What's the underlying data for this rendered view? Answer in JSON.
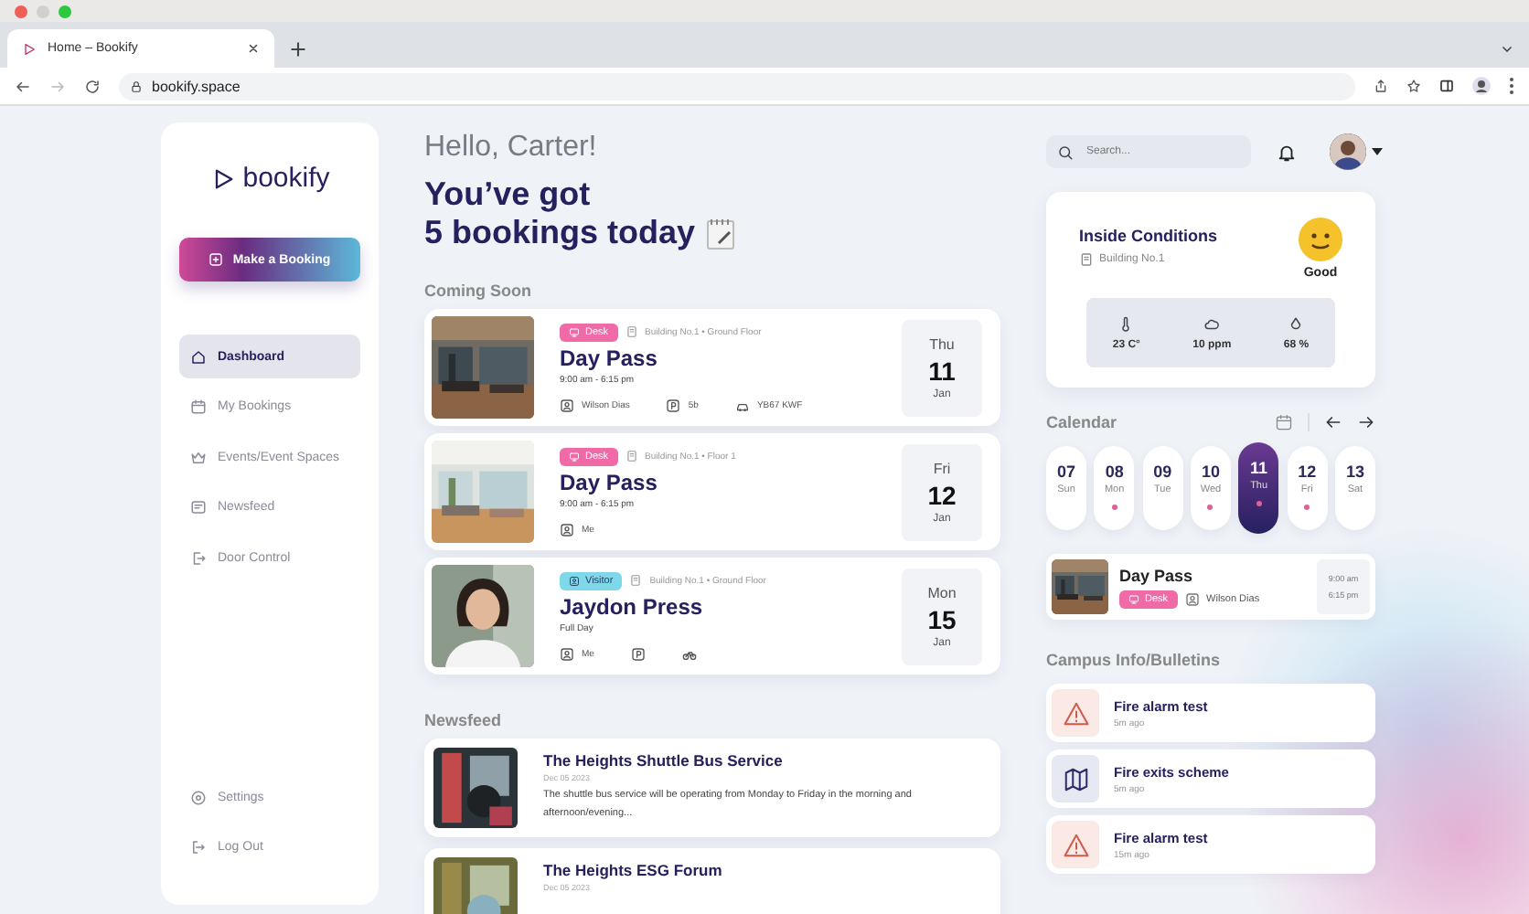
{
  "browser": {
    "tab_title": "Home – Bookify",
    "url": "bookify.space"
  },
  "sidebar": {
    "logo": "bookify",
    "cta": "Make a Booking",
    "nav": [
      {
        "label": "Dashboard",
        "selected": true
      },
      {
        "label": "My Bookings",
        "selected": false
      },
      {
        "label": "Events/Event Spaces",
        "selected": false
      },
      {
        "label": "Newsfeed",
        "selected": false
      },
      {
        "label": "Door Control",
        "selected": false
      }
    ],
    "footer": [
      "Settings",
      "Log Out"
    ]
  },
  "main": {
    "greeting": "Hello, Carter!",
    "headline": [
      "You’ve got",
      "5 bookings today"
    ],
    "coming_soon": {
      "title": "Coming Soon",
      "bookings": [
        {
          "tag": "Desk",
          "kind": "desk",
          "location": "Building No.1 • Ground Floor",
          "title": "Day Pass",
          "time": "9:00 am - 6:15 pm",
          "person": "Wilson Dias",
          "extras": [
            {
              "kind": "parking",
              "text": "5b"
            },
            {
              "kind": "car",
              "text": "YB67 KWF"
            }
          ],
          "day": "Thu",
          "date": "11",
          "month": "Jan"
        },
        {
          "tag": "Desk",
          "kind": "desk",
          "location": "Building No.1 • Floor 1",
          "title": "Day Pass",
          "time": "9:00 am - 6:15 pm",
          "person": "Me",
          "day": "Fri",
          "date": "12",
          "month": "Jan"
        },
        {
          "tag": "Visitor",
          "kind": "visitor",
          "location": "Building No.1 • Ground Floor",
          "title": "Jaydon Press",
          "time": "Full Day",
          "person": "Me",
          "extras": [
            {
              "kind": "parking"
            },
            {
              "kind": "bike"
            }
          ],
          "day": "Mon",
          "date": "15",
          "month": "Jan"
        }
      ]
    },
    "newsfeed": {
      "title": "Newsfeed",
      "items": [
        {
          "title": "The Heights Shuttle Bus Service",
          "date": "Dec 05 2023",
          "body": "The shuttle bus service will be operating from Monday to Friday in the morning and afternoon/evening..."
        },
        {
          "title": "The Heights ESG Forum",
          "date": "Dec 05 2023"
        }
      ]
    }
  },
  "right": {
    "search": {
      "placeholder": "Search..."
    },
    "conditions": {
      "title": "Inside Conditions",
      "building": "Building No.1",
      "mood": "Good",
      "metrics": [
        {
          "kind": "temperature",
          "value": "23 C°"
        },
        {
          "kind": "co2",
          "value": "10 ppm"
        },
        {
          "kind": "humidity",
          "value": "68 %"
        }
      ]
    },
    "calendar": {
      "title": "Calendar",
      "days": [
        {
          "date": "07",
          "day": "Sun",
          "selected": false,
          "has_booking": false
        },
        {
          "date": "08",
          "day": "Mon",
          "selected": false,
          "has_booking": true
        },
        {
          "date": "09",
          "day": "Tue",
          "selected": false,
          "has_booking": false
        },
        {
          "date": "10",
          "day": "Wed",
          "selected": false,
          "has_booking": true
        },
        {
          "date": "11",
          "day": "Thu",
          "selected": true,
          "has_booking": true
        },
        {
          "date": "12",
          "day": "Fri",
          "selected": false,
          "has_booking": true
        },
        {
          "date": "13",
          "day": "Sat",
          "selected": false,
          "has_booking": false
        }
      ],
      "event": {
        "title": "Day Pass",
        "tag": "Desk",
        "person": "Wilson Dias",
        "start": "9:00 am",
        "end": "6:15 pm"
      }
    },
    "bulletins": {
      "title": "Campus Info/Bulletins",
      "items": [
        {
          "kind": "alert",
          "title": "Fire alarm test",
          "time": "5m ago"
        },
        {
          "kind": "map",
          "title": "Fire exits scheme",
          "time": "5m ago"
        },
        {
          "kind": "alert",
          "title": "Fire alarm test",
          "time": "15m ago"
        }
      ]
    }
  }
}
